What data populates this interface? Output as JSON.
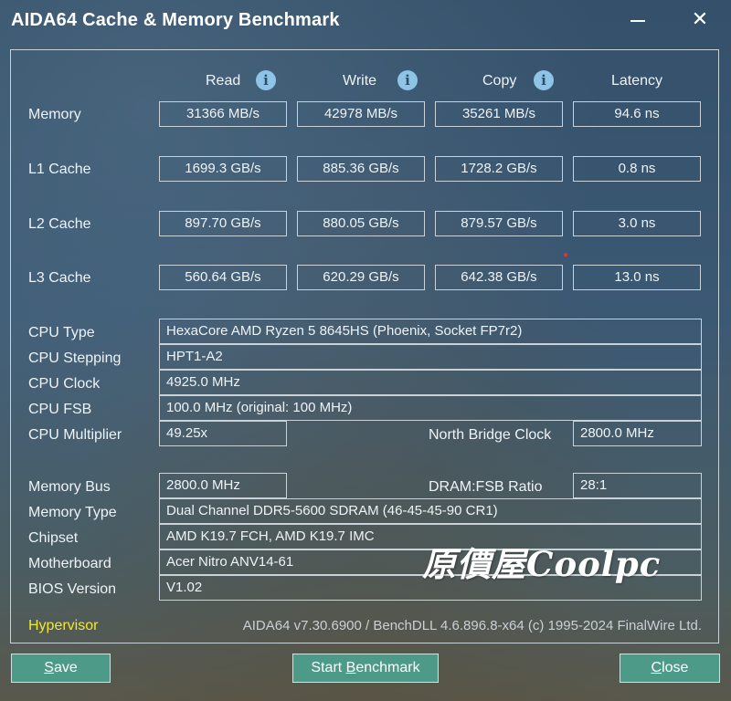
{
  "window": {
    "title": "AIDA64 Cache & Memory Benchmark",
    "minimize": "—",
    "close": "✕"
  },
  "columns": {
    "read": "Read",
    "write": "Write",
    "copy": "Copy",
    "latency": "Latency",
    "info_glyph": "i"
  },
  "rows": [
    {
      "label": "Memory",
      "read": "31366 MB/s",
      "write": "42978 MB/s",
      "copy": "35261 MB/s",
      "latency": "94.6 ns"
    },
    {
      "label": "L1 Cache",
      "read": "1699.3 GB/s",
      "write": "885.36 GB/s",
      "copy": "1728.2 GB/s",
      "latency": "0.8 ns"
    },
    {
      "label": "L2 Cache",
      "read": "897.70 GB/s",
      "write": "880.05 GB/s",
      "copy": "879.57 GB/s",
      "latency": "3.0 ns"
    },
    {
      "label": "L3 Cache",
      "read": "560.64 GB/s",
      "write": "620.29 GB/s",
      "copy": "642.38 GB/s",
      "latency": "13.0 ns"
    }
  ],
  "cpu": {
    "type_label": "CPU Type",
    "type_value": "HexaCore AMD Ryzen 5 8645HS  (Phoenix, Socket FP7r2)",
    "stepping_label": "CPU Stepping",
    "stepping_value": "HPT1-A2",
    "clock_label": "CPU Clock",
    "clock_value": "4925.0 MHz",
    "fsb_label": "CPU FSB",
    "fsb_value": "100.0 MHz  (original: 100 MHz)",
    "multiplier_label": "CPU Multiplier",
    "multiplier_value": "49.25x",
    "nb_clock_label": "North Bridge Clock",
    "nb_clock_value": "2800.0 MHz"
  },
  "memory": {
    "bus_label": "Memory Bus",
    "bus_value": "2800.0 MHz",
    "ratio_label": "DRAM:FSB Ratio",
    "ratio_value": "28:1",
    "type_label": "Memory Type",
    "type_value": "Dual Channel DDR5-5600 SDRAM  (46-45-45-90 CR1)",
    "chipset_label": "Chipset",
    "chipset_value": "AMD K19.7 FCH, AMD K19.7 IMC",
    "motherboard_label": "Motherboard",
    "motherboard_value": "Acer Nitro ANV14-61",
    "bios_label": "BIOS Version",
    "bios_value": "V1.02"
  },
  "footer": {
    "hypervisor": "Hypervisor",
    "version": "AIDA64 v7.30.6900 / BenchDLL 4.6.896.8-x64  (c) 1995-2024 FinalWire Ltd."
  },
  "buttons": {
    "save_mnemonic": "S",
    "save_rest": "ave",
    "start_pre": "Start ",
    "start_mnemonic": "B",
    "start_rest": "enchmark",
    "close_mnemonic": "C",
    "close_rest": "lose"
  },
  "watermark": "原價屋Coolpc",
  "colors": {
    "accent_button": "#4e9a88",
    "hypervisor": "#f0e82a",
    "info_icon": "#8ec5e6"
  }
}
